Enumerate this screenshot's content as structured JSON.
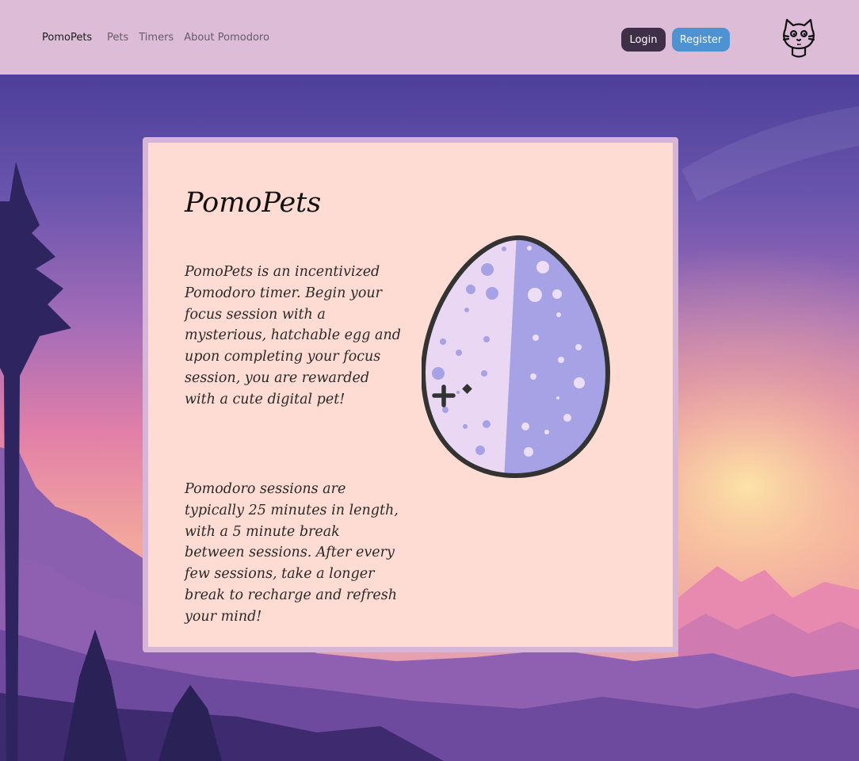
{
  "nav": {
    "brand": "PomoPets",
    "links": [
      {
        "label": "Pets"
      },
      {
        "label": "Timers"
      },
      {
        "label": "About Pomodoro"
      }
    ],
    "login_label": "Login",
    "register_label": "Register",
    "logo_icon": "cat-icon"
  },
  "main": {
    "title": "PomoPets",
    "paragraphs": [
      "PomoPets is an incentivized Pomodoro timer. Begin your focus session with a mysterious, hatchable egg and upon completing your focus session, you are rewarded with a cute digital pet!",
      "Pomodoro sessions are typically 25 minutes in length, with a 5 minute break between sessions. After every few sessions, take a longer break to recharge and refresh your mind!"
    ],
    "illustration_icon": "egg-icon"
  },
  "colors": {
    "navbar_bg": "#dcbcd7",
    "card_bg": "#fedcd3",
    "card_border": "#d6b5d6",
    "login_bg": "#3f2f48",
    "register_bg": "#4f92d1",
    "egg_light": "#e9d7f4",
    "egg_dark": "#a6a2e5"
  }
}
